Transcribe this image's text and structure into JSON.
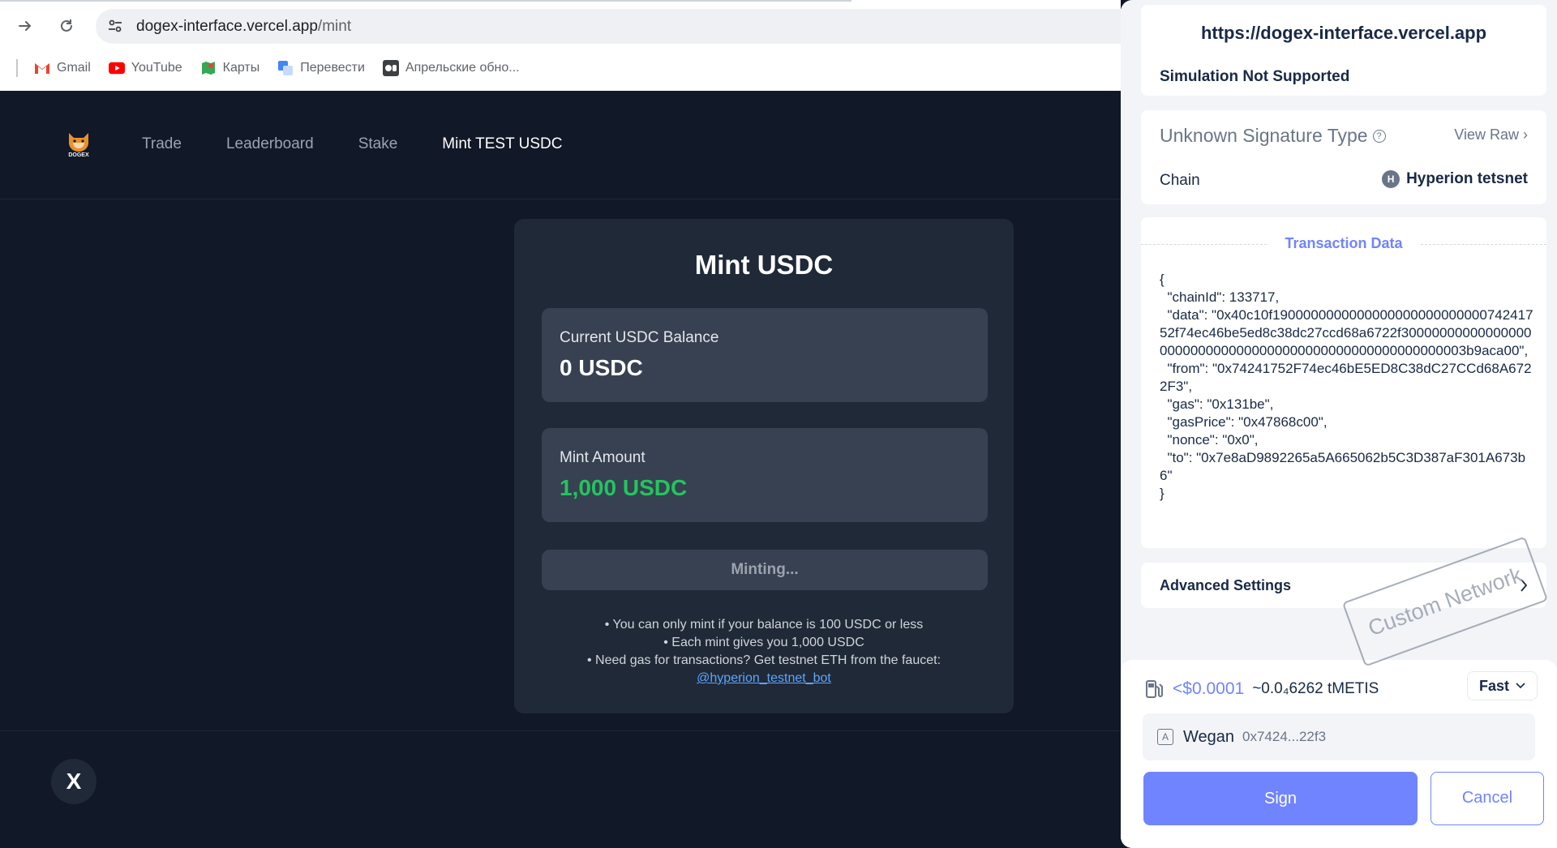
{
  "browser": {
    "url_host": "dogex-interface.vercel.app",
    "url_path": "/mint",
    "bookmarks": [
      {
        "label": "Gmail",
        "icon": "gmail-icon"
      },
      {
        "label": "YouTube",
        "icon": "youtube-icon"
      },
      {
        "label": "Карты",
        "icon": "maps-icon"
      },
      {
        "label": "Перевести",
        "icon": "translate-icon"
      },
      {
        "label": "Апрельские обно...",
        "icon": "bookmark-page-icon"
      }
    ]
  },
  "app": {
    "logo_text": "DOGEX",
    "nav": [
      {
        "label": "Trade",
        "active": false
      },
      {
        "label": "Leaderboard",
        "active": false
      },
      {
        "label": "Stake",
        "active": false
      },
      {
        "label": "Mint TEST USDC",
        "active": true
      }
    ],
    "card": {
      "title": "Mint USDC",
      "balance_label": "Current USDC Balance",
      "balance_value": "0 USDC",
      "amount_label": "Mint Amount",
      "amount_value": "1,000 USDC",
      "button_label": "Minting...",
      "notes": [
        "• You can only mint if your balance is 100 USDC or less",
        "• Each mint gives you 1,000 USDC",
        "• Need gas for transactions? Get testnet ETH from the faucet:"
      ],
      "faucet_link": "@hyperion_testnet_bot"
    },
    "social_icon": "X"
  },
  "wallet": {
    "origin": "https://dogex-interface.vercel.app",
    "simulation": "Simulation Not Supported",
    "signature_type": "Unknown Signature Type",
    "view_raw": "View Raw",
    "chain_label": "Chain",
    "chain_value": "Hyperion tetsnet",
    "chain_icon_letter": "H",
    "tx_header": "Transaction Data",
    "tx_json": "{\n  \"chainId\": 133717,\n  \"data\": \"0x40c10f190000000000000000000000000074241752f74ec46be5ed8c38dc27ccd68a6722f300000000000000000000000000000000000000000000000000000003b9aca00\",\n  \"from\": \"0x74241752F74ec46bE5ED8C38dC27CCd68A6722F3\",\n  \"gas\": \"0x131be\",\n  \"gasPrice\": \"0x47868c00\",\n  \"nonce\": \"0x0\",\n  \"to\": \"0x7e8aD9892265a5A665062b5C3D387aF301A673b6\"\n}",
    "advanced_settings": "Advanced Settings",
    "stamp": "Custom Network",
    "gas_usd": "<$0.0001",
    "gas_native": "~0.0₄6262 tMETIS",
    "speed": "Fast",
    "account_badge": "A",
    "account_name": "Wegan",
    "account_address": "0x7424...22f3",
    "sign_label": "Sign",
    "cancel_label": "Cancel",
    "accent_color": "#7084ff"
  }
}
